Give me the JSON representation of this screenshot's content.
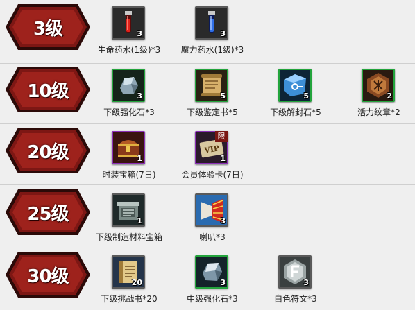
{
  "levels": [
    {
      "label": "3级",
      "items": [
        {
          "name": "生命药水(1级)*3",
          "count": "3",
          "icon": "red-potion-icon"
        },
        {
          "name": "魔力药水(1级)*3",
          "count": "3",
          "icon": "blue-potion-icon"
        }
      ]
    },
    {
      "label": "10级",
      "items": [
        {
          "name": "下级强化石*3",
          "count": "3",
          "icon": "enhance-stone-icon"
        },
        {
          "name": "下级鉴定书*5",
          "count": "5",
          "icon": "appraisal-scroll-icon"
        },
        {
          "name": "下级解封石*5",
          "count": "5",
          "icon": "unseal-stone-icon"
        },
        {
          "name": "活力纹章*2",
          "count": "2",
          "icon": "vitality-emblem-icon"
        }
      ]
    },
    {
      "label": "20级",
      "items": [
        {
          "name": "时装宝箱(7日)",
          "count": "1",
          "icon": "fashion-chest-icon"
        },
        {
          "name": "会员体验卡(7日)",
          "count": "1",
          "icon": "vip-card-icon",
          "limit": "限"
        }
      ]
    },
    {
      "label": "25级",
      "items": [
        {
          "name": "下级制造材料宝箱",
          "count": "1",
          "icon": "material-box-icon"
        },
        {
          "name": "喇叭*3",
          "count": "3",
          "icon": "horn-icon"
        }
      ]
    },
    {
      "label": "30级",
      "items": [
        {
          "name": "下级挑战书*20",
          "count": "20",
          "icon": "challenge-book-icon"
        },
        {
          "name": "中级强化石*3",
          "count": "3",
          "icon": "mid-enhance-stone-icon"
        },
        {
          "name": "白色符文*3",
          "count": "3",
          "icon": "white-rune-icon"
        }
      ]
    }
  ]
}
